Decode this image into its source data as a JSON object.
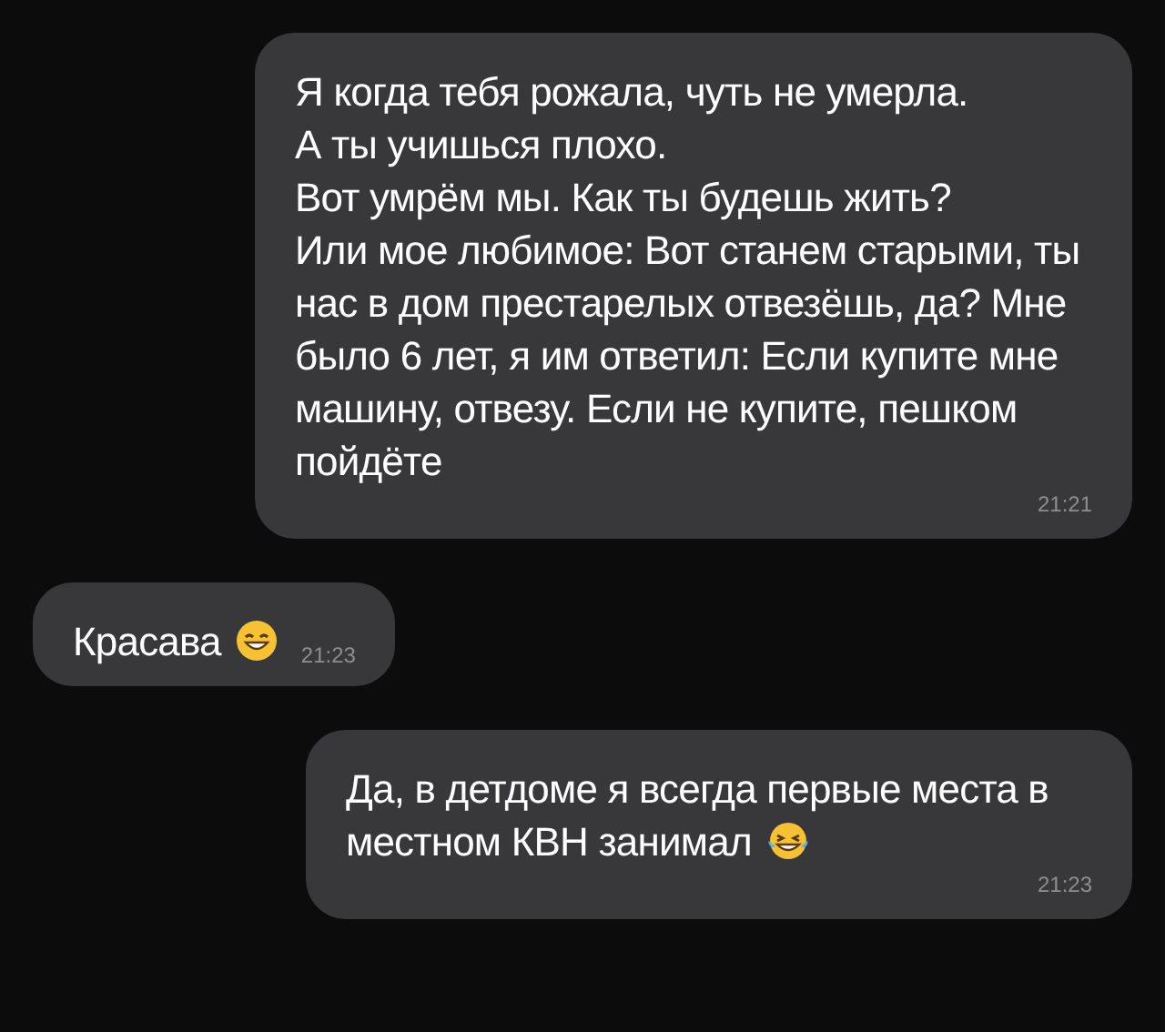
{
  "messages": [
    {
      "kind": "outgoing",
      "text": "Я когда тебя рожала, чуть не умерла.\nА ты учишься плохо.\nВот умрём мы. Как ты будешь жить?\nИли мое любимое: Вот станем старыми, ты нас в дом престарелых отвезёшь, да? Мне было 6 лет, я им ответил: Если купите мне машину, отвезу. Если не купите, пешком пойдёте",
      "time": "21:21"
    },
    {
      "kind": "incoming",
      "text": "Красава",
      "emoji": {
        "kind": "smile"
      },
      "time": "21:23"
    },
    {
      "kind": "outgoing",
      "text": "Да, в детдоме я всегда первые места в местном КВН занимал",
      "emoji": {
        "kind": "tears"
      },
      "time": "21:23"
    }
  ]
}
